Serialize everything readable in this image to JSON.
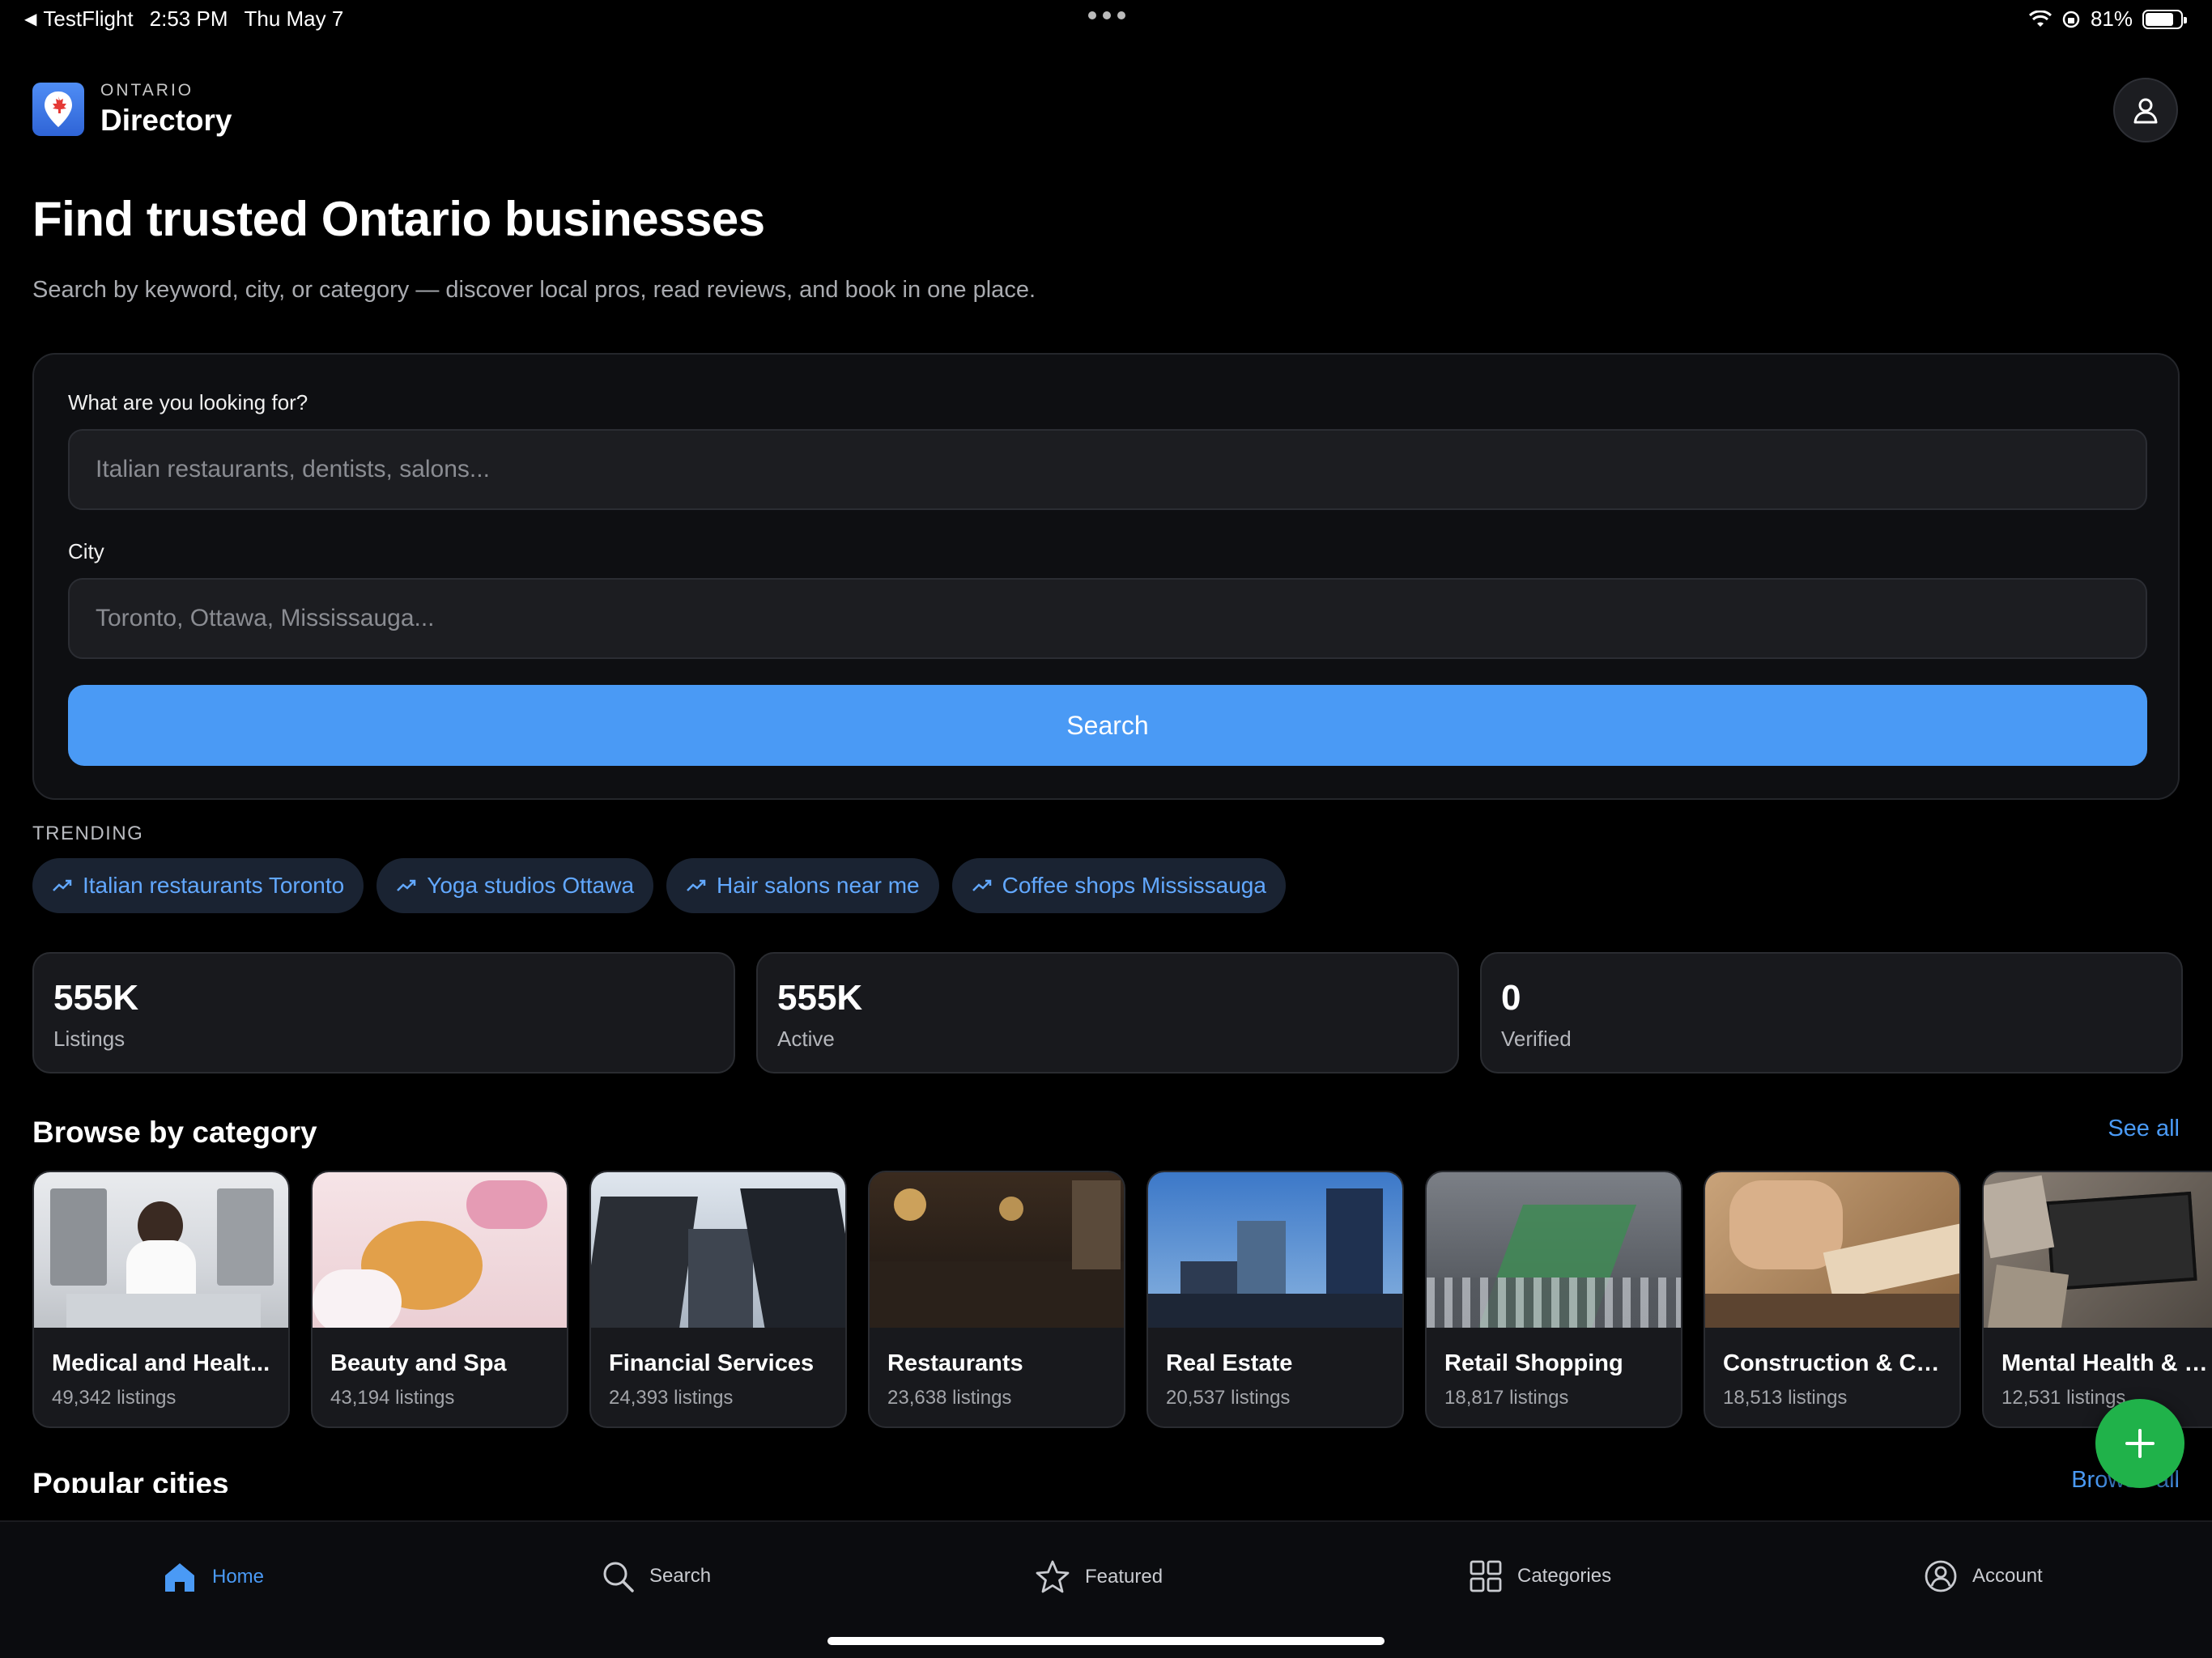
{
  "status_bar": {
    "back_app": "TestFlight",
    "time": "2:53 PM",
    "date": "Thu May 7",
    "battery_percent": "81%",
    "battery_level": 0.81
  },
  "header": {
    "brand_sub": "ONTARIO",
    "brand_title": "Directory"
  },
  "hero": {
    "title": "Find trusted Ontario businesses",
    "subtitle": "Search by keyword, city, or category — discover local pros, read reviews, and book in one place."
  },
  "search_form": {
    "keyword_label": "What are you looking for?",
    "keyword_placeholder": "Italian restaurants, dentists, salons...",
    "city_label": "City",
    "city_placeholder": "Toronto, Ottawa, Mississauga...",
    "button_label": "Search"
  },
  "trending": {
    "label": "TRENDING",
    "chips": [
      "Italian restaurants Toronto",
      "Yoga studios Ottawa",
      "Hair salons near me",
      "Coffee shops Mississauga"
    ]
  },
  "stats": [
    {
      "value": "555K",
      "label": "Listings"
    },
    {
      "value": "555K",
      "label": "Active"
    },
    {
      "value": "0",
      "label": "Verified"
    }
  ],
  "categories_section": {
    "title": "Browse by category",
    "see_all": "See all",
    "items": [
      {
        "name": "Medical and Healt...",
        "count": "49,342 listings"
      },
      {
        "name": "Beauty and Spa",
        "count": "43,194 listings"
      },
      {
        "name": "Financial Services",
        "count": "24,393 listings"
      },
      {
        "name": "Restaurants",
        "count": "23,638 listings"
      },
      {
        "name": "Real Estate",
        "count": "20,537 listings"
      },
      {
        "name": "Retail Shopping",
        "count": "18,817 listings"
      },
      {
        "name": "Construction & Co...",
        "count": "18,513 listings"
      },
      {
        "name": "Mental Health & W...",
        "count": "12,531 listings"
      }
    ]
  },
  "popular_section": {
    "title": "Popular cities",
    "browse_all": "Browse all"
  },
  "tabbar": {
    "tabs": [
      {
        "label": "Home",
        "icon": "home-icon"
      },
      {
        "label": "Search",
        "icon": "search-icon"
      },
      {
        "label": "Featured",
        "icon": "star-icon"
      },
      {
        "label": "Categories",
        "icon": "grid-icon"
      },
      {
        "label": "Account",
        "icon": "account-icon"
      }
    ],
    "active": "Home"
  },
  "colors": {
    "accent": "#4a9af5",
    "fab": "#20b24a",
    "background": "#000000",
    "card": "#18191d"
  }
}
